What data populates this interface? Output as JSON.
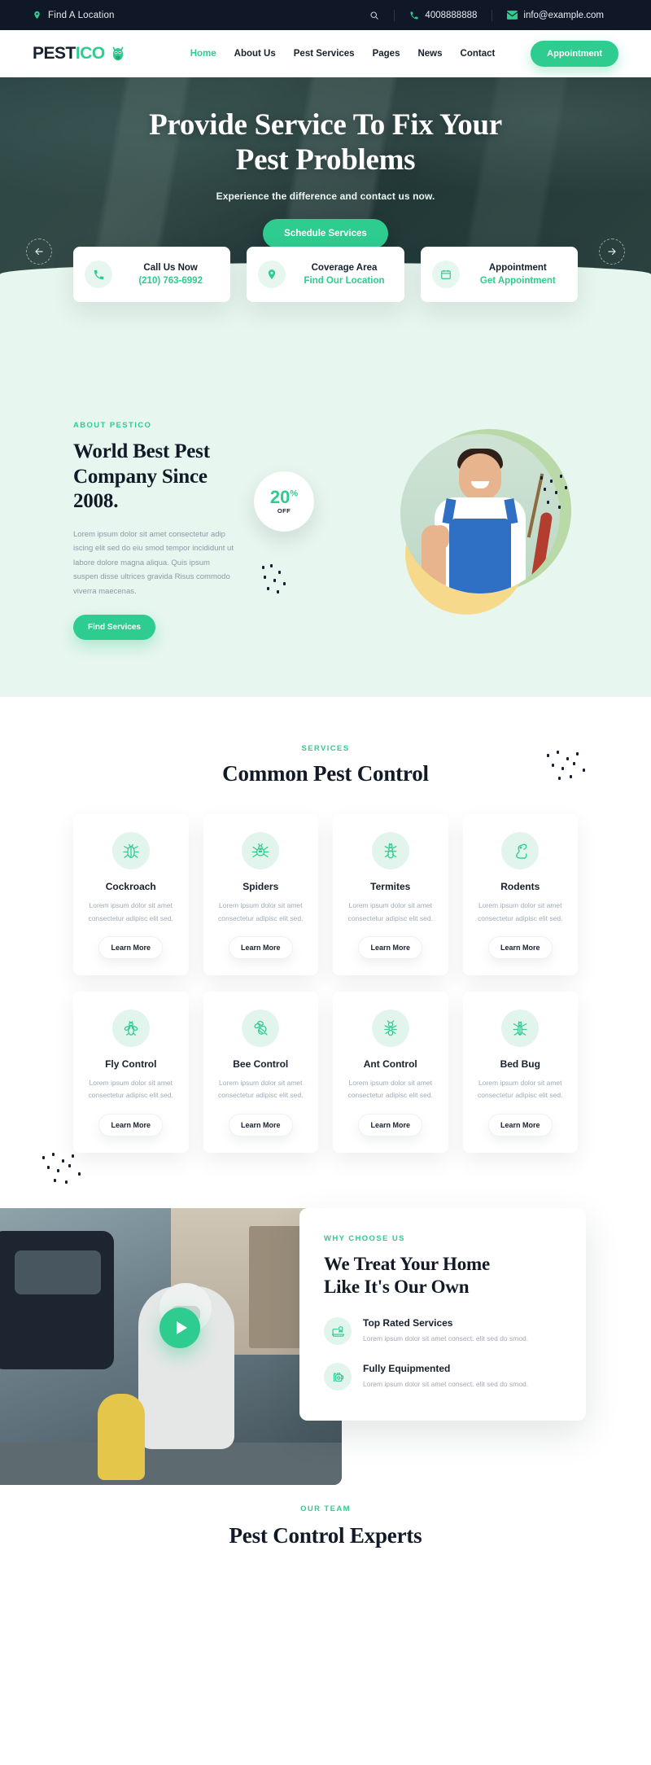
{
  "topbar": {
    "location_label": "Find A Location",
    "location_icon": "map-pin-icon",
    "search_icon": "search-icon",
    "phone_icon": "phone-icon",
    "phone": "4008888888",
    "email_icon": "envelope-icon",
    "email": "info@example.com"
  },
  "header": {
    "logo_part1": "PEST",
    "logo_part2": "ICO",
    "logo_mark": "bug-mascot-icon",
    "nav": [
      {
        "label": "Home",
        "active": true
      },
      {
        "label": "About Us",
        "active": false
      },
      {
        "label": "Pest Services",
        "active": false
      },
      {
        "label": "Pages",
        "active": false
      },
      {
        "label": "News",
        "active": false
      },
      {
        "label": "Contact",
        "active": false
      }
    ],
    "appointment_label": "Appointment"
  },
  "hero": {
    "title_line1": "Provide Service To Fix Your",
    "title_line2": "Pest Problems",
    "subtitle": "Experience the difference and contact us now.",
    "cta_label": "Schedule Services",
    "prev_icon": "arrow-left-icon",
    "next_icon": "arrow-right-icon"
  },
  "info_cards": [
    {
      "icon": "phone-icon",
      "title": "Call Us Now",
      "value": "(210) 763-6992"
    },
    {
      "icon": "map-pin-icon",
      "title": "Coverage Area",
      "value": "Find Our Location"
    },
    {
      "icon": "calendar-icon",
      "title": "Appointment",
      "value": "Get Appointment"
    }
  ],
  "about": {
    "eyebrow": "ABOUT PESTICO",
    "heading": "World Best Pest Company Since 2008.",
    "paragraph": "Lorem ipsum dolor sit amet consectetur adip iscing elit sed do eiu smod tempor incididunt ut labore dolore magna aliqua. Quis ipsum suspen disse ultrices gravida Risus commodo viverra maecenas.",
    "cta_label": "Find Services",
    "badge_number": "20",
    "badge_percent": "%",
    "badge_off": "OFF"
  },
  "services": {
    "eyebrow": "SERVICES",
    "heading": "Common Pest Control",
    "learn_more_label": "Learn More",
    "description": "Lorem ipsum dolor sit amet consectetur adipisc elit sed.",
    "items": [
      {
        "name": "Cockroach",
        "icon": "cockroach-icon"
      },
      {
        "name": "Spiders",
        "icon": "spider-icon"
      },
      {
        "name": "Termites",
        "icon": "termite-icon"
      },
      {
        "name": "Rodents",
        "icon": "rodent-icon"
      },
      {
        "name": "Fly Control",
        "icon": "fly-icon"
      },
      {
        "name": "Bee Control",
        "icon": "bee-icon"
      },
      {
        "name": "Ant Control",
        "icon": "ant-icon"
      },
      {
        "name": "Bed Bug",
        "icon": "bedbug-icon"
      }
    ]
  },
  "why": {
    "eyebrow": "WHY CHOOSE US",
    "heading_line1": "We Treat Your Home",
    "heading_line2": "Like It's Our Own",
    "play_icon": "play-icon",
    "features": [
      {
        "icon": "award-laptop-icon",
        "title": "Top Rated Services",
        "desc": "Lorem ipsum dolor sit amet consect. elit sed do smod."
      },
      {
        "icon": "equipment-icon",
        "title": "Fully Equipmented",
        "desc": "Lorem ipsum dolor sit amet consect. elit sed do smod."
      }
    ]
  },
  "team": {
    "eyebrow": "OUR TEAM",
    "heading": "Pest Control Experts"
  },
  "colors": {
    "accent": "#2ecc8f",
    "dark": "#101828",
    "mint_bg": "#e7f6ef"
  }
}
